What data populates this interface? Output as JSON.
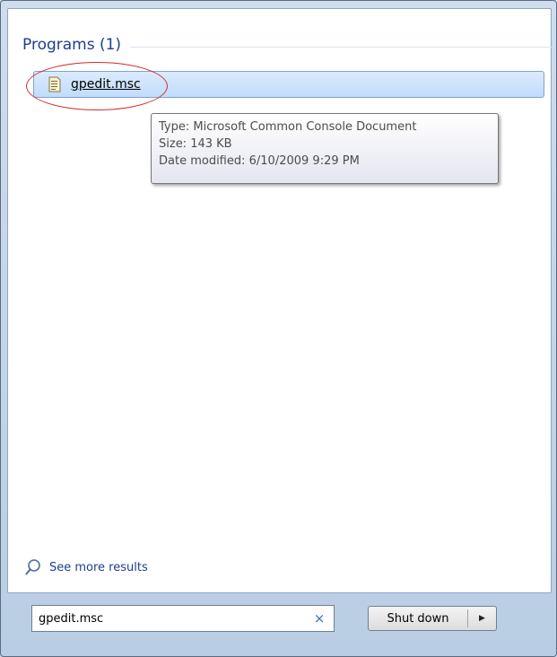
{
  "programs_group": {
    "header": "Programs (1)",
    "items": [
      {
        "label": "gpedit.msc",
        "icon": "console-document-icon"
      }
    ]
  },
  "tooltip": {
    "type": "Type: Microsoft Common Console Document",
    "size": "Size: 143 KB",
    "date_modified": "Date modified: 6/10/2009 9:29 PM"
  },
  "see_more": {
    "label": "See more results",
    "icon": "magnifier-icon"
  },
  "search": {
    "value": "gpedit.msc",
    "clear_icon": "×"
  },
  "shutdown": {
    "label": "Shut down",
    "arrow": "▶"
  },
  "colors": {
    "highlight_ring": "#d22b2b",
    "link_blue": "#1e3e8c",
    "selection_fill": "#c1dcfc"
  }
}
